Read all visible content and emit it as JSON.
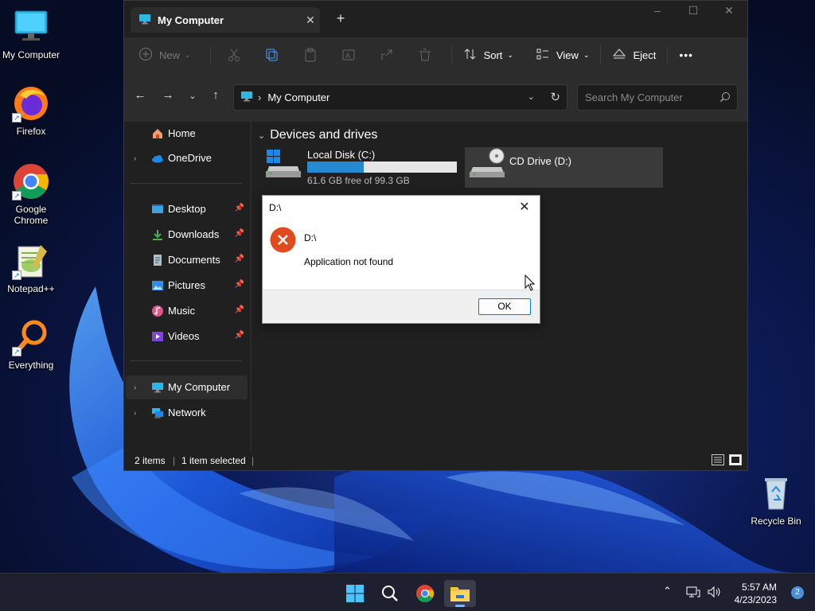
{
  "desktop": {
    "icons": [
      {
        "label": "My Computer"
      },
      {
        "label": "Firefox"
      },
      {
        "label": "Google Chrome"
      },
      {
        "label": "Notepad++"
      },
      {
        "label": "Everything"
      },
      {
        "label": "Recycle Bin"
      }
    ]
  },
  "window": {
    "tab_title": "My Computer",
    "tab_close": "✕",
    "new_tab": "+",
    "toolbar": {
      "new_label": "New",
      "sort_label": "Sort",
      "view_label": "View",
      "eject_label": "Eject",
      "more_label": "•••"
    },
    "address": {
      "location": "My Computer",
      "search_placeholder": "Search My Computer"
    },
    "nav": {
      "items": [
        {
          "label": "Home"
        },
        {
          "label": "OneDrive"
        },
        {
          "label": "Desktop"
        },
        {
          "label": "Downloads"
        },
        {
          "label": "Documents"
        },
        {
          "label": "Pictures"
        },
        {
          "label": "Music"
        },
        {
          "label": "Videos"
        },
        {
          "label": "My Computer"
        },
        {
          "label": "Network"
        }
      ]
    },
    "content": {
      "group_title": "Devices and drives",
      "drives": [
        {
          "name": "Local Disk (C:)",
          "free_text": "61.6 GB free of 99.3 GB",
          "used_fraction": 0.38
        },
        {
          "name": "CD Drive (D:)"
        }
      ]
    },
    "status": {
      "item_count": "2 items",
      "selection": "1 item selected"
    }
  },
  "dialog": {
    "title": "D:\\",
    "close": "✕",
    "line1": "D:\\",
    "line2": "Application not found",
    "ok_label": "OK"
  },
  "taskbar": {
    "time": "5:57 AM",
    "date": "4/23/2023",
    "notifications": "2"
  },
  "colors": {
    "accent": "#268ad2",
    "error_icon": "#e04a1f",
    "taskbar": "#1e2030"
  }
}
